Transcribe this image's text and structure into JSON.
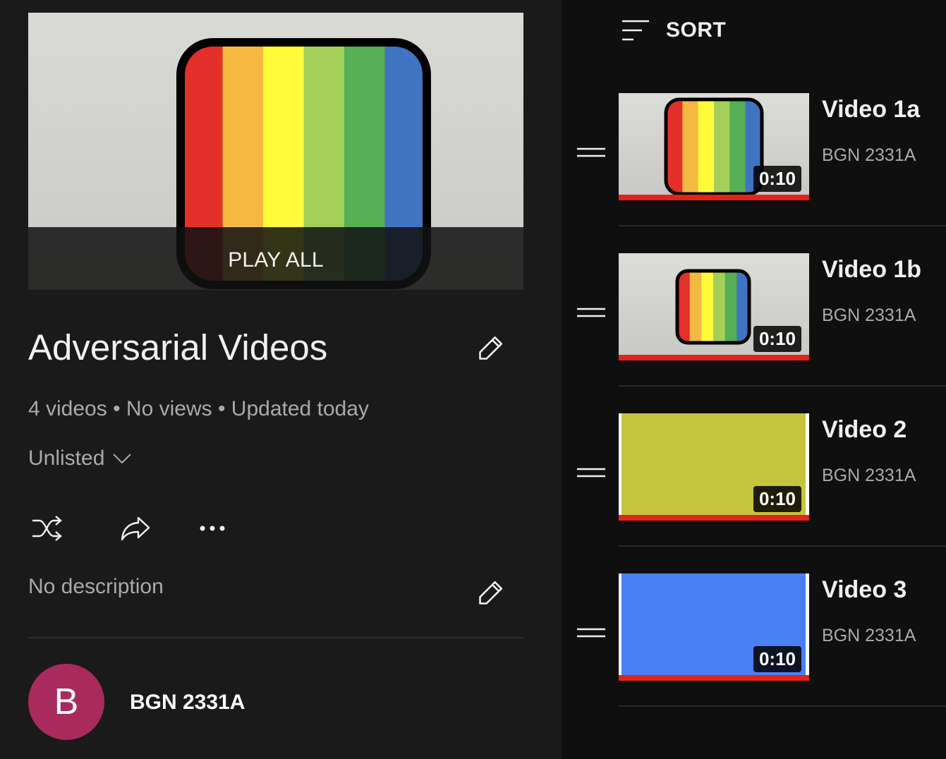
{
  "playlist": {
    "play_all_label": "PLAY ALL",
    "title": "Adversarial Videos",
    "stats": "4 videos • No views • Updated today",
    "privacy": "Unlisted",
    "description": "No description",
    "owner": {
      "avatar_letter": "B",
      "name": "BGN 2331A",
      "avatar_color": "#a92a5c"
    }
  },
  "actions": [
    "shuffle-icon",
    "share-icon",
    "more-icon"
  ],
  "sort": {
    "label": "SORT"
  },
  "videos": [
    {
      "title": "Video 1a",
      "channel": "BGN 2331A",
      "duration": "0:10",
      "thumb": "rainbow-large"
    },
    {
      "title": "Video 1b",
      "channel": "BGN 2331A",
      "duration": "0:10",
      "thumb": "rainbow-small"
    },
    {
      "title": "Video 2",
      "channel": "BGN 2331A",
      "duration": "0:10",
      "thumb": "solid",
      "color": "#c6c43d"
    },
    {
      "title": "Video 3",
      "channel": "BGN 2331A",
      "duration": "0:10",
      "thumb": "solid",
      "color": "#4a7ff5"
    }
  ],
  "colors": {
    "rainbow": [
      "#e3302a",
      "#f5b942",
      "#fffb3b",
      "#a4d05a",
      "#56ae55",
      "#3f74c2"
    ],
    "progress": "#e62117"
  }
}
